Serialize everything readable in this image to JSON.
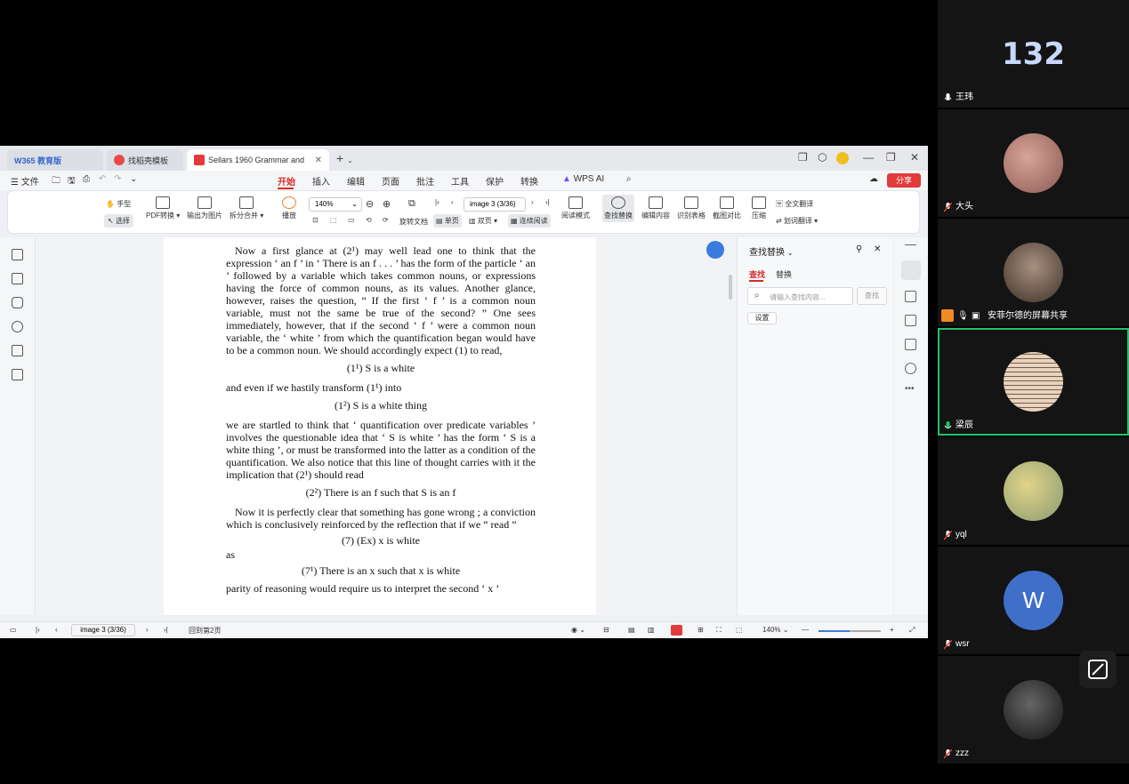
{
  "tabs": [
    {
      "label": "W365 教育版"
    },
    {
      "label": "找稻壳模板"
    },
    {
      "label": "Sellars 1960 Grammar and"
    }
  ],
  "menubar": {
    "file": "文件",
    "items": [
      "开始",
      "插入",
      "编辑",
      "页面",
      "批注",
      "工具",
      "保护",
      "转换"
    ],
    "wps_ai": "WPS AI",
    "share": "分享"
  },
  "ribbon": {
    "hand": "手型",
    "select": "选择",
    "pdf_convert": "PDF转换",
    "export_image": "输出为图片",
    "split_merge": "拆分合并",
    "play": "播放",
    "zoom": "140%",
    "rotate": "旋转文档",
    "single": "单页",
    "double": "双页",
    "continuous": "连续阅读",
    "page_display": "image 3 (3/36)",
    "read_mode": "阅读模式",
    "find_replace": "查找替换",
    "edit_content": "编辑内容",
    "recognize_table": "识别表格",
    "screenshot_compare": "截图对比",
    "compress": "压缩",
    "full_translate": "全文翻译",
    "word_translate": "划词翻译"
  },
  "document": {
    "p1": "Now a first glance at (2¹) may well lead one to think that the expression ‘ an f ’ in ‘ There is an f . . . ’ has the form of the particle ‘ an ’ followed by a variable which takes common nouns, or expressions having the force of common nouns, as its values. Another glance, however, raises the question, “ If the first ‘ f ’ is a common noun variable, must not the same be true of the second? ” One sees immediately, however, that if the second ‘ f ’ were a common noun variable, the ‘ white ’ from which the quantification began would have to be a common noun. We should accordingly expect (1) to read,",
    "f1": "(1¹) S is a white",
    "p2": "and even if we hastily transform (1¹) into",
    "f2": "(1²) S is a white thing",
    "p3": "we are startled to think that ‘ quantification over predicate variables ’ involves the questionable idea that ‘ S is white ’ has the form ‘ S is a white thing ’, or must be transformed into the latter as a condition of the quantification. We also notice that this line of thought carries with it the implication that (2¹) should read",
    "f3": "(2²) There is an f such that S is an f",
    "p4": "Now it is perfectly clear that something has gone wrong ; a conviction which is conclusively reinforced by the reflection that if we “ read ”",
    "f4": "(7) (Ex) x is white",
    "p5": "as",
    "f5": "(7¹) There is an x such that x is white",
    "p6": "parity of reasoning would require us to interpret the second ‘ x ’"
  },
  "find_panel": {
    "title": "查找替换",
    "tab_find": "查找",
    "tab_replace": "替换",
    "placeholder": "请输入查找内容...",
    "find_btn": "查找",
    "settings": "设置"
  },
  "statusbar": {
    "page": "image 3 (3/36)",
    "back": "回到第2页",
    "zoom": "140%"
  },
  "participants": [
    {
      "name": "王玮",
      "avatar_text": "132",
      "color": "#1a4fa0"
    },
    {
      "name": "大头",
      "avatar_text": "",
      "color": "#b07a6a"
    },
    {
      "name": "安菲尔德的屏幕共享",
      "avatar_text": "",
      "color": "#6b5a4a"
    },
    {
      "name": "梁辰",
      "avatar_text": "",
      "color": "#d8c0a8"
    },
    {
      "name": "yql",
      "avatar_text": "",
      "color": "#c8b870"
    },
    {
      "name": "wsr",
      "avatar_text": "W",
      "color": "#3f6fc8"
    },
    {
      "name": "zzz",
      "avatar_text": "",
      "color": "#2a2a2a"
    }
  ]
}
